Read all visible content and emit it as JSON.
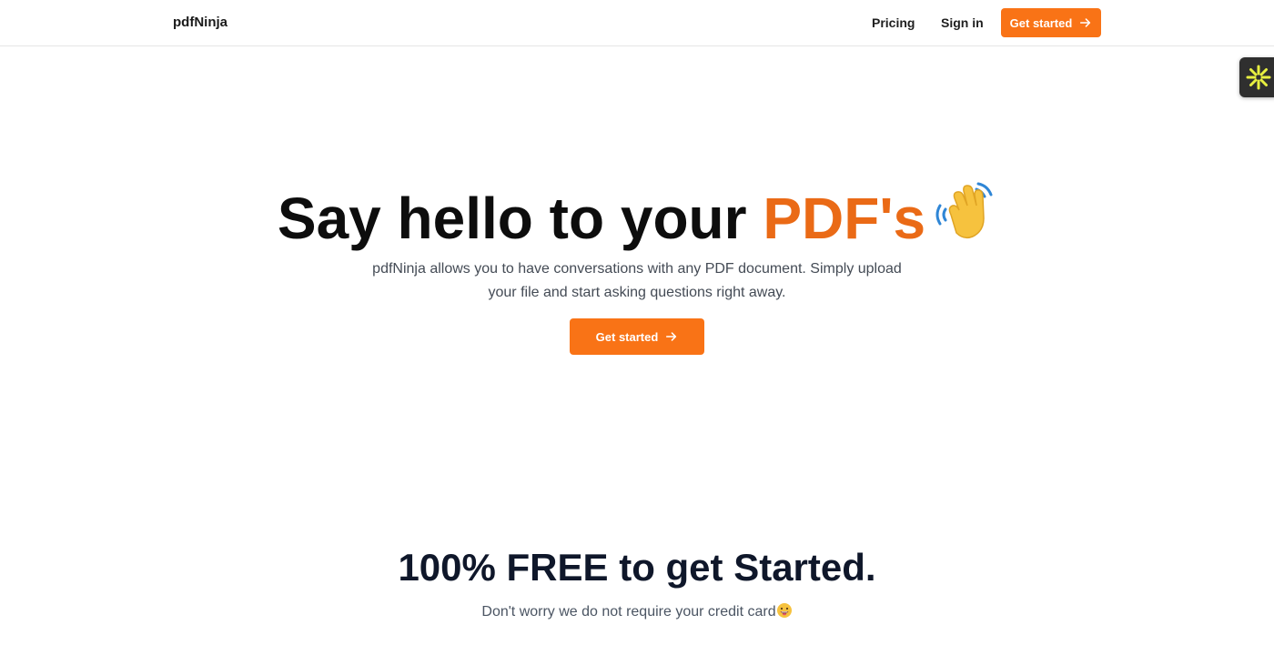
{
  "nav": {
    "brand": "pdfNinja",
    "pricing": "Pricing",
    "sign_in": "Sign in",
    "cta": "Get started",
    "cta_icon": "arrow-right-icon"
  },
  "widget": {
    "icon": "asterisk-icon"
  },
  "hero": {
    "title_main": "Say hello to your ",
    "title_accent": "PDF's",
    "title_icon": "waving-hand-icon",
    "subtitle": "pdfNinja allows you to have conversations with any PDF document. Simply upload your file and start asking questions right away.",
    "cta": "Get started",
    "cta_icon": "arrow-right-icon"
  },
  "free": {
    "title": "100% FREE to get Started.",
    "subtitle": "Don't worry we do not require your credit card",
    "subtitle_icon": "grinning-face-icon"
  },
  "colors": {
    "accent": "#f97316",
    "accent_text": "#ea6a16",
    "widget_bg": "#2f2f2f",
    "widget_icon": "#e8f040"
  }
}
